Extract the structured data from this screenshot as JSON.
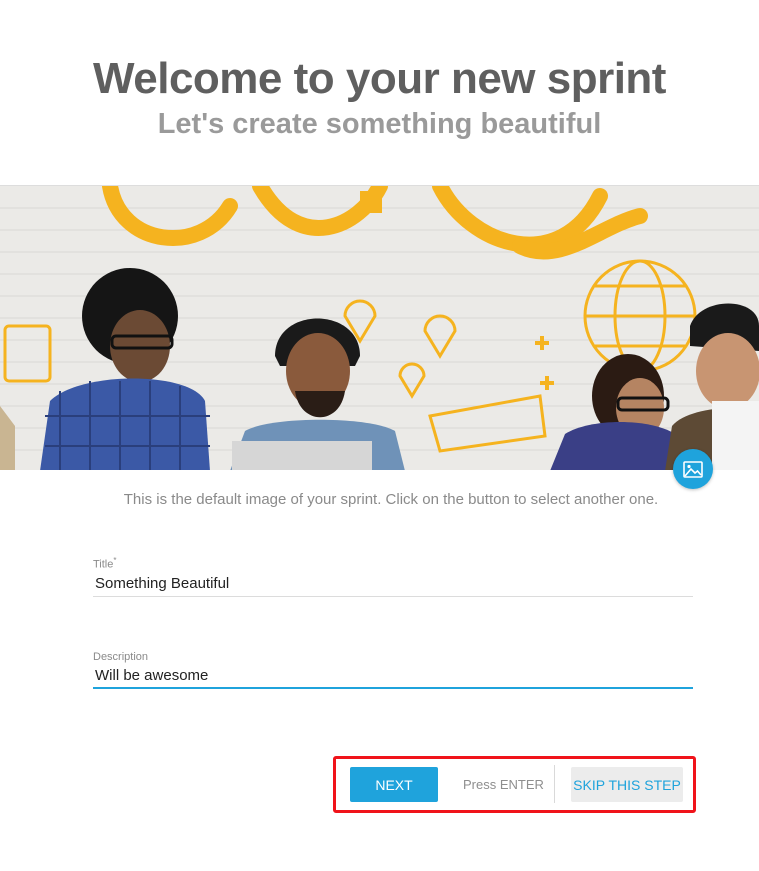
{
  "header": {
    "title": "Welcome to your new sprint",
    "subtitle": "Let's create something beautiful"
  },
  "banner": {
    "image_description_icon": "change-image-icon",
    "caption": "This is the default image of your sprint. Click on the button to select another one."
  },
  "form": {
    "title_label": "Title",
    "title_required_mark": "*",
    "title_value": "Something Beautiful",
    "description_label": "Description",
    "description_value": "Will be awesome"
  },
  "actions": {
    "next_label": "NEXT",
    "hint": "Press ENTER",
    "skip_label": "SKIP THIS STEP"
  },
  "colors": {
    "accent": "#1fa3dc",
    "highlight_box": "#f0131a",
    "banner_yellow": "#f5b31f"
  }
}
